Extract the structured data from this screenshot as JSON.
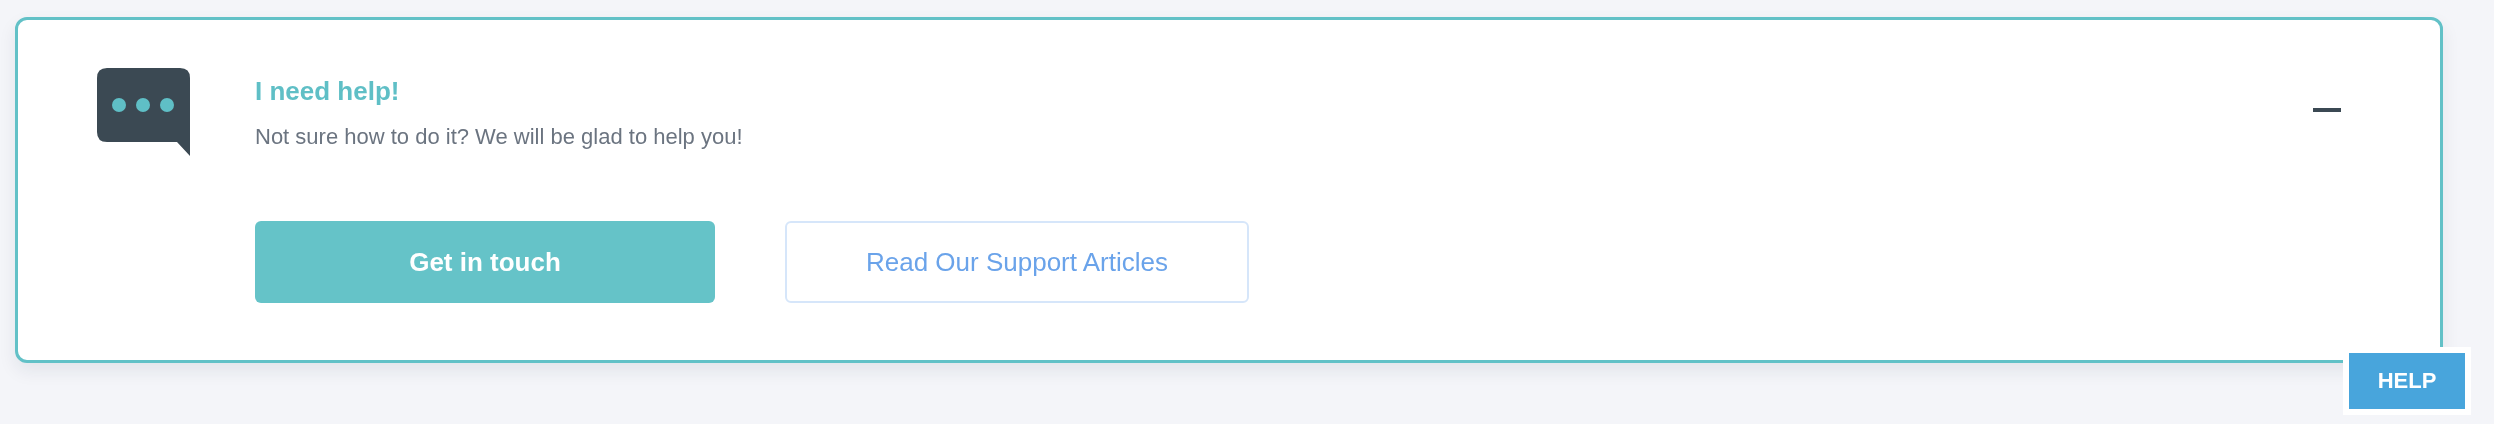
{
  "panel": {
    "title": "I need help!",
    "subtitle": "Not sure how to do it? We will be glad to help you!",
    "expanded": true,
    "buttons": [
      {
        "label": "Get in touch",
        "kind": "primary"
      },
      {
        "label": "Read Our Support Articles",
        "kind": "outline"
      }
    ]
  },
  "help_tab": {
    "label": "HELP"
  }
}
